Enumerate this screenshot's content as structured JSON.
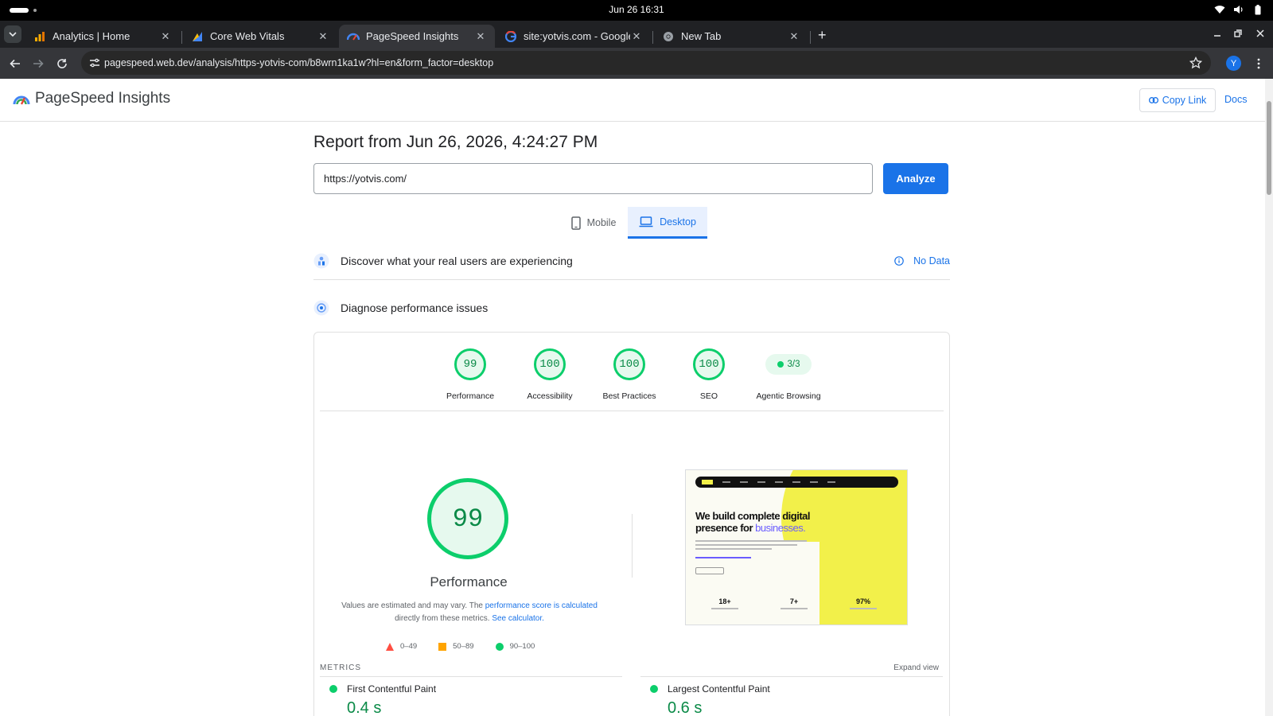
{
  "os": {
    "clock": "Jun 26  16:31"
  },
  "tabs": [
    {
      "title": "Analytics | Home",
      "icon": "analytics-icon",
      "active": false
    },
    {
      "title": "Core Web Vitals",
      "icon": "search-console-icon",
      "active": false
    },
    {
      "title": "PageSpeed Insights",
      "icon": "pagespeed-icon",
      "active": true
    },
    {
      "title": "site:yotvis.com - Google",
      "icon": "google-icon",
      "active": false
    },
    {
      "title": "New Tab",
      "icon": "chrome-icon",
      "active": false
    }
  ],
  "toolbar": {
    "url": "pagespeed.web.dev/analysis/https-yotvis-com/b8wrn1ka1w?hl=en&form_factor=desktop",
    "profile_initial": "Y"
  },
  "header": {
    "brand": "PageSpeed Insights",
    "copy_link": "Copy Link",
    "docs": "Docs"
  },
  "report": {
    "title": "Report from Jun 26, 2026, 4:24:27 PM",
    "url_value": "https://yotvis.com/",
    "analyze": "Analyze"
  },
  "devices": {
    "mobile": "Mobile",
    "desktop": "Desktop",
    "selected": "desktop"
  },
  "sections": {
    "discover": "Discover what your real users are experiencing",
    "no_data": "No Data",
    "diagnose": "Diagnose performance issues"
  },
  "scores": [
    {
      "value": "99",
      "label": "Performance"
    },
    {
      "value": "100",
      "label": "Accessibility"
    },
    {
      "value": "100",
      "label": "Best Practices"
    },
    {
      "value": "100",
      "label": "SEO"
    }
  ],
  "agentic": {
    "value": "3/3",
    "label": "Agentic Browsing"
  },
  "performance": {
    "score": "99",
    "title": "Performance",
    "note_1": "Values are estimated and may vary. The",
    "note_link_1": "performance score is calculated",
    "note_2": "directly from these metrics.",
    "note_link_2": "See calculator."
  },
  "legend": {
    "poor": "0–49",
    "average": "50–89",
    "good": "90–100"
  },
  "screenshot": {
    "headline_1": "We build complete digital",
    "headline_2": "presence for",
    "headline_highlight": "businesses.",
    "stats": [
      "18+",
      "7+",
      "97%"
    ]
  },
  "metrics": {
    "label": "METRICS",
    "expand": "Expand view",
    "items": [
      {
        "name": "First Contentful Paint",
        "value": "0.4 s"
      },
      {
        "name": "Largest Contentful Paint",
        "value": "0.6 s"
      }
    ]
  },
  "colors": {
    "good": "#0cce6b",
    "average": "#ffa400",
    "poor": "#ff4e42",
    "accent": "#1a73e8"
  }
}
